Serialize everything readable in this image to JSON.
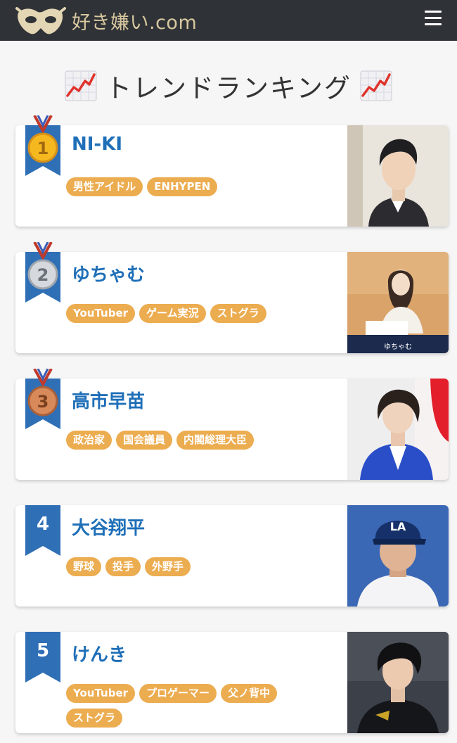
{
  "header": {
    "site_name": "好き嫌い.com",
    "menu_icon": "hamburger-icon",
    "logo_icon": "mask-icon"
  },
  "page": {
    "title": "トレンドランキング",
    "title_icon": "chart-increasing-icon"
  },
  "colors": {
    "header_bg": "#2f3236",
    "name": "#1f6fb8",
    "tag": "#ecac50",
    "ribbon": "#2f6fb6"
  },
  "ranking": [
    {
      "rank": "1",
      "medal": "gold-medal-icon",
      "name": "NI-KI",
      "tags": [
        "男性アイドル",
        "ENHYPEN"
      ]
    },
    {
      "rank": "2",
      "medal": "silver-medal-icon",
      "name": "ゆちゃむ",
      "tags": [
        "YouTuber",
        "ゲーム実況",
        "ストグラ"
      ],
      "photo_caption": "ゆちゃむ"
    },
    {
      "rank": "3",
      "medal": "bronze-medal-icon",
      "name": "高市早苗",
      "tags": [
        "政治家",
        "国会議員",
        "内閣総理大臣"
      ]
    },
    {
      "rank": "4",
      "name": "大谷翔平",
      "tags": [
        "野球",
        "投手",
        "外野手"
      ]
    },
    {
      "rank": "5",
      "name": "けんき",
      "tags": [
        "YouTuber",
        "プロゲーマー",
        "父ノ背中",
        "ストグラ"
      ]
    }
  ]
}
